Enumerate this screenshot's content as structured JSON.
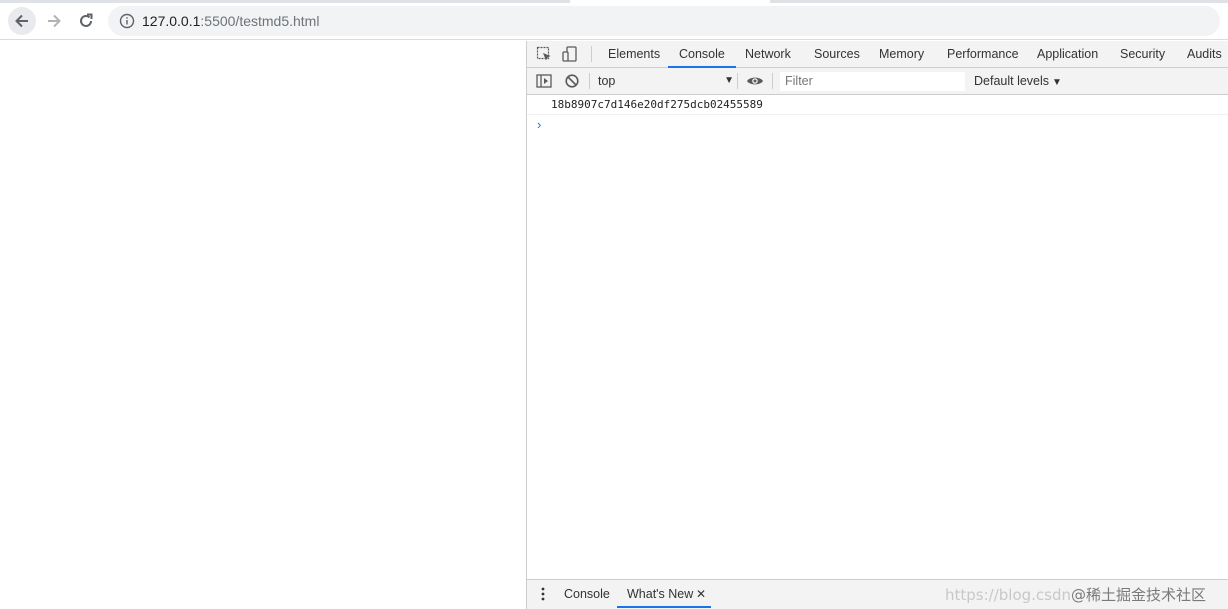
{
  "browser": {
    "url_host": "127.0.0.1",
    "url_rest": ":5500/testmd5.html"
  },
  "devtools": {
    "tabs": [
      "Elements",
      "Console",
      "Network",
      "Sources",
      "Memory",
      "Performance",
      "Application",
      "Security",
      "Audits"
    ],
    "active_tab": "Console",
    "console_toolbar": {
      "context": "top",
      "filter_placeholder": "Filter",
      "levels": "Default levels"
    },
    "console_output": [
      "18b8907c7d146e20df275dcb02455589"
    ],
    "drawer": {
      "tabs": [
        "Console",
        "What's New"
      ],
      "active_tab": "What's New"
    }
  },
  "watermark": {
    "url_part": "https://blog.csdn",
    "brand": "@稀土掘金技术社区"
  },
  "colors": {
    "accent": "#1a73e8",
    "panel_bg": "#f3f3f3"
  }
}
